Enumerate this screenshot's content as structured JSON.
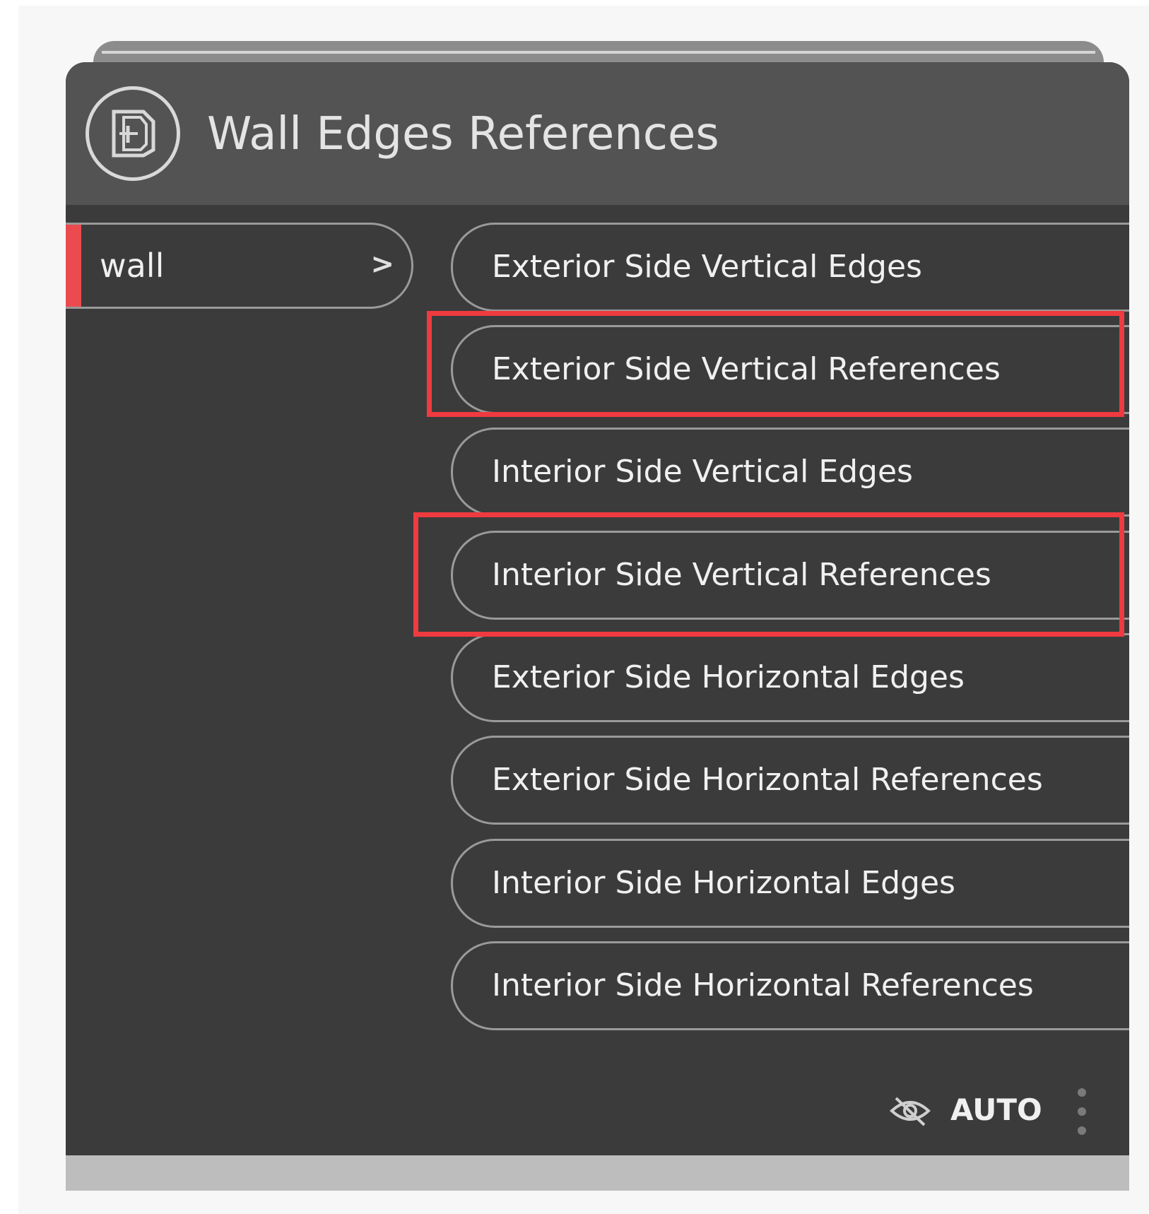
{
  "node": {
    "title": "Wall Edges References",
    "icon": "wall-node-icon"
  },
  "inputs": [
    {
      "label": "wall",
      "arrow": ">"
    }
  ],
  "outputs": [
    {
      "label": "Exterior Side Vertical Edges",
      "highlighted": false
    },
    {
      "label": "Exterior Side Vertical References",
      "highlighted": true
    },
    {
      "label": "Interior Side Vertical Edges",
      "highlighted": false
    },
    {
      "label": "Interior Side Vertical References",
      "highlighted": true
    },
    {
      "label": "Exterior Side Horizontal Edges",
      "highlighted": false
    },
    {
      "label": "Exterior Side Horizontal References",
      "highlighted": false
    },
    {
      "label": "Interior Side Horizontal Edges",
      "highlighted": false
    },
    {
      "label": "Interior Side Horizontal References",
      "highlighted": false
    }
  ],
  "footer": {
    "visibility_icon": "eye-hidden-icon",
    "run_mode": "AUTO",
    "menu_icon": "more-vertical-icon"
  },
  "colors": {
    "node_body": "#3b3b3b",
    "node_header": "#535353",
    "port_marker": "#eb4a4f",
    "highlight": "#ef3b40"
  }
}
